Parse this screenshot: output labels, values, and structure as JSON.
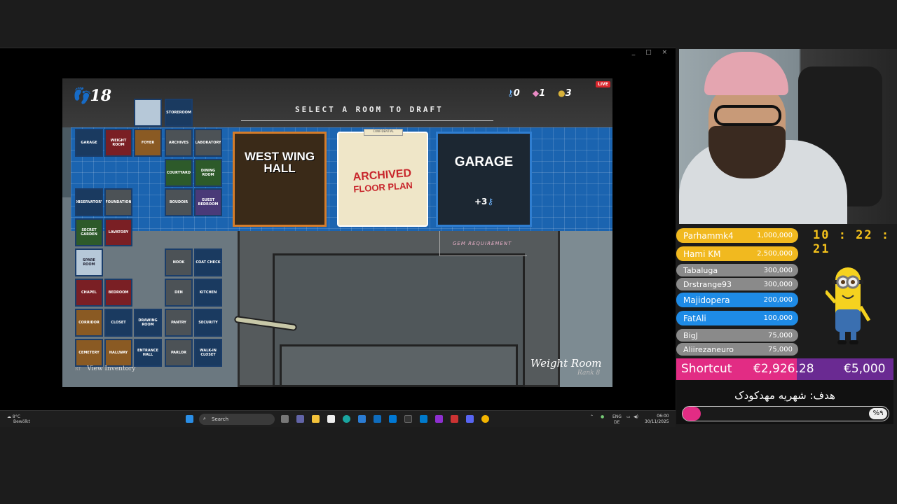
{
  "window": {
    "controls": "_ □ ×"
  },
  "game": {
    "steps": "18",
    "keys": "0",
    "gems": "1",
    "coins": "3",
    "live_badge": "LIVE",
    "select_label": "SELECT A ROOM TO DRAFT",
    "tiles": [
      "GARAGE",
      "WEIGHT ROOM",
      "FOYER",
      "ARCHIVES",
      "LABORATORY",
      "STOREROOM",
      "COURTYARD",
      "DINING ROOM",
      "OBSERVATORY",
      "FOUNDATION",
      "BOUDOIR",
      "GUEST BEDROOM",
      "SECRET GARDEN",
      "LAVATORY",
      "SPARE ROOM",
      "NOOK",
      "COAT CHECK",
      "CHAPEL",
      "BEDROOM",
      "DEN",
      "KITCHEN",
      "CORRIDOR",
      "CLOSET",
      "DRAWING ROOM",
      "PANTRY",
      "SECURITY",
      "CEMETERY",
      "HALLWAY",
      "ENTRANCE HALL",
      "PARLOR",
      "WALK-IN CLOSET"
    ],
    "cards": [
      {
        "label_line1": "WEST WING",
        "label_line2": "HALL"
      },
      {
        "tab": "CONFIDENTIAL",
        "label_line1": "ARCHIVED",
        "label_line2": "FLOOR PLAN"
      },
      {
        "label": "GARAGE",
        "bonus": "+3"
      }
    ],
    "gem_requirement": "GEM REQUIREMENT",
    "view_inventory": "View Inventory",
    "view_inventory_key": "RT",
    "room_name": "Weight Room",
    "room_rank": "Rank 8"
  },
  "taskbar": {
    "weather_temp": "8°C",
    "weather_desc": "Bewölkt",
    "search_placeholder": "Search",
    "lang1": "ENG",
    "lang2": "DE",
    "time": "06:00",
    "date": "30/11/2025"
  },
  "overlay": {
    "timer": "10 : 22 : 21",
    "donations": [
      {
        "name": "Parhammk4",
        "amount": "1,000,000",
        "color": "yellow"
      },
      {
        "name": "Hami KM",
        "amount": "2,500,000",
        "color": "yellow"
      },
      {
        "name": "Tabaluga",
        "amount": "300,000",
        "color": "grey"
      },
      {
        "name": "Drstrange93",
        "amount": "300,000",
        "color": "grey"
      },
      {
        "name": "Majidopera",
        "amount": "200,000",
        "color": "blue"
      },
      {
        "name": "FatAli",
        "amount": "100,000",
        "color": "blue"
      },
      {
        "name": "BigJ",
        "amount": "75,000",
        "color": "grey"
      },
      {
        "name": "Aliirezaneuro",
        "amount": "75,000",
        "color": "grey"
      }
    ],
    "shortcut_label": "Shortcut",
    "shortcut_current": "€2,926.28",
    "shortcut_goal": "€5,000",
    "goal_text": "هدف: شهریه مهدکودک",
    "goal_percent": "%۹",
    "goal_progress": 0.09
  },
  "colors": {
    "accent_yellow": "#f1b91f",
    "accent_pink": "#e22c84",
    "accent_blue": "#1e8be6",
    "grid_blue": "#1b64b0"
  }
}
